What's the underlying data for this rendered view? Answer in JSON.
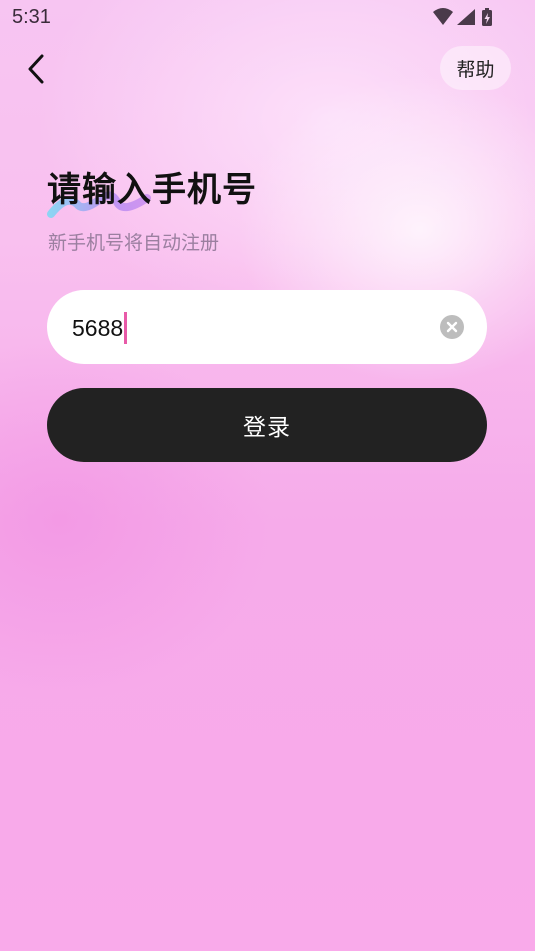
{
  "status_bar": {
    "time": "5:31",
    "icons": [
      "wifi-icon",
      "signal-icon",
      "battery-charging-icon"
    ]
  },
  "header": {
    "back_icon": "back-chevron-icon",
    "help_label": "帮助"
  },
  "main": {
    "title": "请输入手机号",
    "subtitle": "新手机号将自动注册",
    "phone_input": {
      "value": "5688",
      "clear_icon": "clear-icon"
    },
    "login_label": "登录"
  },
  "colors": {
    "button_dark": "#222222",
    "caret": "#e85aa8",
    "subtitle": "#9b7fa0",
    "input_bg": "#ffffff"
  }
}
